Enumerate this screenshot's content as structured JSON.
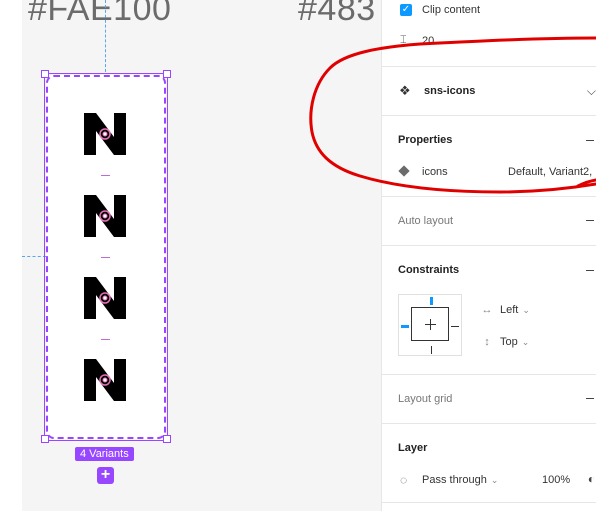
{
  "canvas": {
    "hex_labels": [
      "#FAE100",
      "#483"
    ],
    "component_set": {
      "variants_badge": "4 Variants",
      "add_variant_symbol": "+",
      "variant_glyph": "N",
      "variant_count": 4
    }
  },
  "panel": {
    "frame": {
      "clip_content_label": "Clip content",
      "clip_content_checked": true,
      "spacing_value": "20"
    },
    "component": {
      "name": "sns-icons",
      "icon": "component-set-icon"
    },
    "properties": {
      "title": "Properties",
      "items": [
        {
          "name": "icons",
          "value": "Default, Variant2,",
          "icon": "variant-property-icon"
        }
      ]
    },
    "auto_layout": {
      "title": "Auto layout"
    },
    "constraints": {
      "title": "Constraints",
      "horizontal": "Left",
      "vertical": "Top"
    },
    "layout_grid": {
      "title": "Layout grid"
    },
    "layer": {
      "title": "Layer",
      "blend_mode": "Pass through",
      "opacity": "100%"
    }
  },
  "colors": {
    "selection": "#9747ff",
    "accent": "#0d99ff",
    "annotation": "#e00000"
  }
}
